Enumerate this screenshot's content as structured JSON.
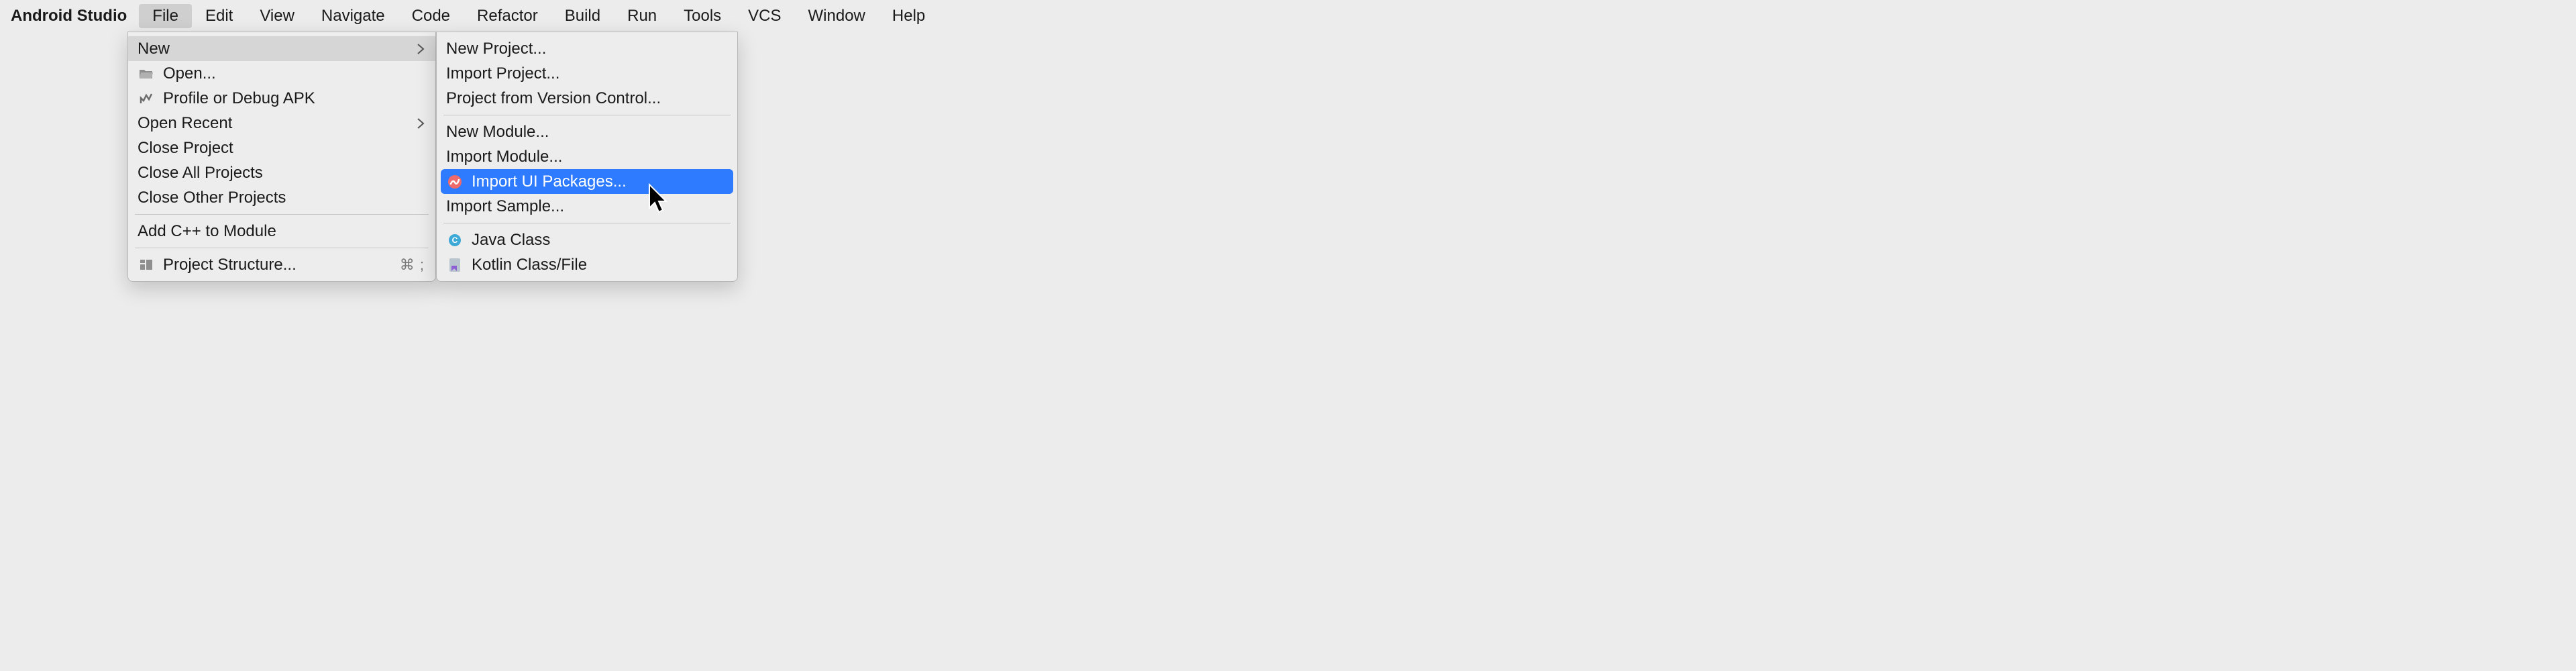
{
  "app_name": "Android Studio",
  "menubar": {
    "items": [
      "File",
      "Edit",
      "View",
      "Navigate",
      "Code",
      "Refactor",
      "Build",
      "Run",
      "Tools",
      "VCS",
      "Window",
      "Help"
    ],
    "open_index": 0
  },
  "file_menu": {
    "new": "New",
    "open": "Open...",
    "profile_debug": "Profile or Debug APK",
    "open_recent": "Open Recent",
    "close_project": "Close Project",
    "close_all": "Close All Projects",
    "close_other": "Close Other Projects",
    "add_cpp": "Add C++ to Module",
    "project_structure": "Project Structure...",
    "project_structure_shortcut": "⌘ ;"
  },
  "new_submenu": {
    "new_project": "New Project...",
    "import_project": "Import Project...",
    "proj_vcs": "Project from Version Control...",
    "new_module": "New Module...",
    "import_module": "Import Module...",
    "import_ui_packages": "Import UI Packages...",
    "import_sample": "Import Sample...",
    "java_class": "Java Class",
    "kotlin_class": "Kotlin Class/File"
  },
  "icons": {
    "folder": "folder-open-icon",
    "profile": "profile-icon",
    "structure": "project-structure-icon",
    "relay": "relay-icon",
    "java": "java-class-icon",
    "kotlin": "kotlin-file-icon"
  }
}
